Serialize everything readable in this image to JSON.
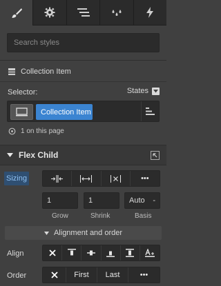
{
  "tabs": [
    {
      "name": "style-tab",
      "icon": "brush-icon",
      "active": true
    },
    {
      "name": "settings-tab",
      "icon": "gear-icon",
      "active": false
    },
    {
      "name": "navigator-tab",
      "icon": "list-icon",
      "active": false
    },
    {
      "name": "interactions-tab",
      "icon": "drops-icon",
      "active": false
    },
    {
      "name": "lightning-tab",
      "icon": "lightning-icon",
      "active": false
    }
  ],
  "search": {
    "placeholder": "Search styles"
  },
  "context": {
    "label": "Collection Item"
  },
  "selector": {
    "label": "Selector:",
    "states_label": "States",
    "chip": "Collection Item",
    "on_page": "1 on this page"
  },
  "flex_child": {
    "title": "Flex Child",
    "sizing_label": "Sizing",
    "sizing_more": "•••",
    "grow_value": "1",
    "shrink_value": "1",
    "basis_value": "Auto",
    "basis_unit": "-",
    "grow_label": "Grow",
    "shrink_label": "Shrink",
    "basis_label": "Basis",
    "alignment_title": "Alignment and order",
    "align_label": "Align",
    "order_label": "Order",
    "order_first": "First",
    "order_last": "Last",
    "order_more": "•••"
  },
  "colors": {
    "panel": "#404040",
    "dark": "#2b2b2b",
    "accent": "#3b84d1"
  }
}
